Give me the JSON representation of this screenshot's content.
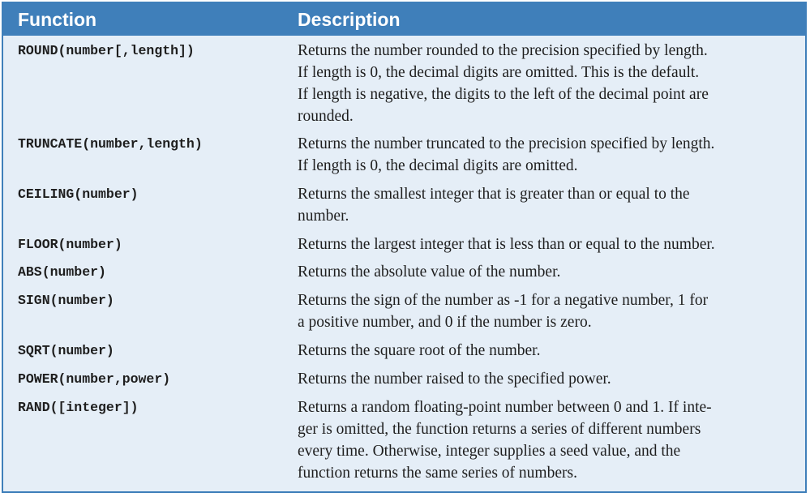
{
  "table": {
    "headers": {
      "function": "Function",
      "description": "Description"
    },
    "rows": [
      {
        "function": "ROUND(number[,length])",
        "description_lines": [
          "Returns the number rounded to the precision specified by length.",
          "If length is 0, the decimal digits are omitted. This is the default.",
          "If length is negative, the digits to the left of the decimal point are",
          "rounded."
        ]
      },
      {
        "function": "TRUNCATE(number,length)",
        "description_lines": [
          "Returns the number truncated to the precision specified by length.",
          "If length is 0, the decimal digits are omitted."
        ]
      },
      {
        "function": "CEILING(number)",
        "description_lines": [
          "Returns the smallest integer that is greater than or equal to the",
          "number."
        ]
      },
      {
        "function": "FLOOR(number)",
        "description_lines": [
          "Returns the largest integer that is less than or equal to the number."
        ]
      },
      {
        "function": "ABS(number)",
        "description_lines": [
          "Returns the absolute value of the number."
        ]
      },
      {
        "function": "SIGN(number)",
        "description_lines": [
          "Returns the sign of the number as -1 for a negative number, 1 for",
          "a positive number, and 0 if the number is zero."
        ]
      },
      {
        "function": "SQRT(number)",
        "description_lines": [
          "Returns the square root of the number."
        ]
      },
      {
        "function": "POWER(number,power)",
        "description_lines": [
          "Returns the number raised to the specified power."
        ]
      },
      {
        "function": "RAND([integer])",
        "description_lines": [
          "Returns a random floating-point number between 0 and 1. If inte-",
          "ger is omitted, the function returns a series of different numbers",
          "every time. Otherwise, integer supplies a seed value, and the",
          "function returns the same series of numbers."
        ]
      }
    ]
  },
  "colors": {
    "header_bg": "#3f7fba",
    "body_bg": "#e5eef7",
    "text": "#1e1e1e"
  }
}
